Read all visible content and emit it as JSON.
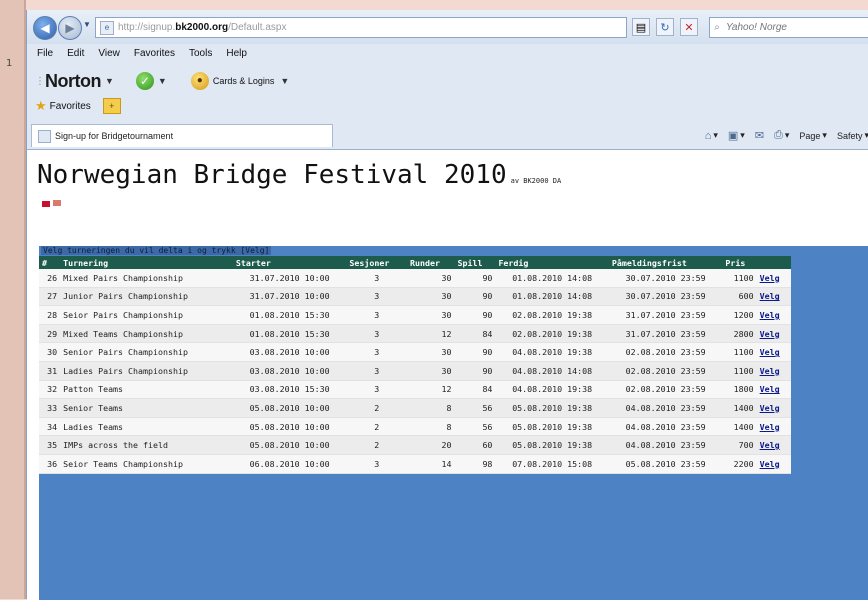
{
  "browser": {
    "url_prefix": "http://signup.",
    "url_host": "bk2000.org",
    "url_path": "/Default.aspx",
    "search_placeholder": "Yahoo! Norge",
    "menu": [
      "File",
      "Edit",
      "View",
      "Favorites",
      "Tools",
      "Help"
    ],
    "norton_label": "Norton",
    "cards_label": "Cards & Logins",
    "favorites_label": "Favorites",
    "tab_title": "Sign-up for Bridgetournament",
    "cmd_page": "Page",
    "cmd_safety": "Safety"
  },
  "page": {
    "title": "Norwegian Bridge Festival 2010",
    "byline": "av BK2000 DA",
    "instruction": "Velg turneringen du vil delta i og trykk [Velg]"
  },
  "table": {
    "headers": [
      "#",
      "Turnering",
      "Starter",
      "Sesjoner",
      "Runder",
      "Spill",
      "Ferdig",
      "Påmeldingsfrist",
      "Pris",
      ""
    ],
    "rows": [
      {
        "id": "26",
        "name": "Mixed Pairs Championship",
        "start": "31.07.2010 10:00",
        "sessions": "3",
        "rounds": "30",
        "boards": "90",
        "end": "01.08.2010 14:08",
        "deadline": "30.07.2010 23:59",
        "price": "1100",
        "action": "Velg"
      },
      {
        "id": "27",
        "name": "Junior Pairs Championship",
        "start": "31.07.2010 10:00",
        "sessions": "3",
        "rounds": "30",
        "boards": "90",
        "end": "01.08.2010 14:08",
        "deadline": "30.07.2010 23:59",
        "price": "600",
        "action": "Velg"
      },
      {
        "id": "28",
        "name": "Seior Pairs Championship",
        "start": "01.08.2010 15:30",
        "sessions": "3",
        "rounds": "30",
        "boards": "90",
        "end": "02.08.2010 19:38",
        "deadline": "31.07.2010 23:59",
        "price": "1200",
        "action": "Velg"
      },
      {
        "id": "29",
        "name": "Mixed Teams Championship",
        "start": "01.08.2010 15:30",
        "sessions": "3",
        "rounds": "12",
        "boards": "84",
        "end": "02.08.2010 19:38",
        "deadline": "31.07.2010 23:59",
        "price": "2800",
        "action": "Velg"
      },
      {
        "id": "30",
        "name": "Senior Pairs Championship",
        "start": "03.08.2010 10:00",
        "sessions": "3",
        "rounds": "30",
        "boards": "90",
        "end": "04.08.2010 19:38",
        "deadline": "02.08.2010 23:59",
        "price": "1100",
        "action": "Velg"
      },
      {
        "id": "31",
        "name": "Ladies Pairs Championship",
        "start": "03.08.2010 10:00",
        "sessions": "3",
        "rounds": "30",
        "boards": "90",
        "end": "04.08.2010 14:08",
        "deadline": "02.08.2010 23:59",
        "price": "1100",
        "action": "Velg"
      },
      {
        "id": "32",
        "name": "Patton Teams",
        "start": "03.08.2010 15:30",
        "sessions": "3",
        "rounds": "12",
        "boards": "84",
        "end": "04.08.2010 19:38",
        "deadline": "02.08.2010 23:59",
        "price": "1800",
        "action": "Velg"
      },
      {
        "id": "33",
        "name": "Senior Teams",
        "start": "05.08.2010 10:00",
        "sessions": "2",
        "rounds": "8",
        "boards": "56",
        "end": "05.08.2010 19:38",
        "deadline": "04.08.2010 23:59",
        "price": "1400",
        "action": "Velg"
      },
      {
        "id": "34",
        "name": "Ladies Teams",
        "start": "05.08.2010 10:00",
        "sessions": "2",
        "rounds": "8",
        "boards": "56",
        "end": "05.08.2010 19:38",
        "deadline": "04.08.2010 23:59",
        "price": "1400",
        "action": "Velg"
      },
      {
        "id": "35",
        "name": "IMPs across the field",
        "start": "05.08.2010 10:00",
        "sessions": "2",
        "rounds": "20",
        "boards": "60",
        "end": "05.08.2010 19:38",
        "deadline": "04.08.2010 23:59",
        "price": "700",
        "action": "Velg"
      },
      {
        "id": "36",
        "name": "Seior Teams Championship",
        "start": "06.08.2010 10:00",
        "sessions": "3",
        "rounds": "14",
        "boards": "98",
        "end": "07.08.2010 15:08",
        "deadline": "05.08.2010 23:59",
        "price": "2200",
        "action": "Velg"
      }
    ]
  }
}
